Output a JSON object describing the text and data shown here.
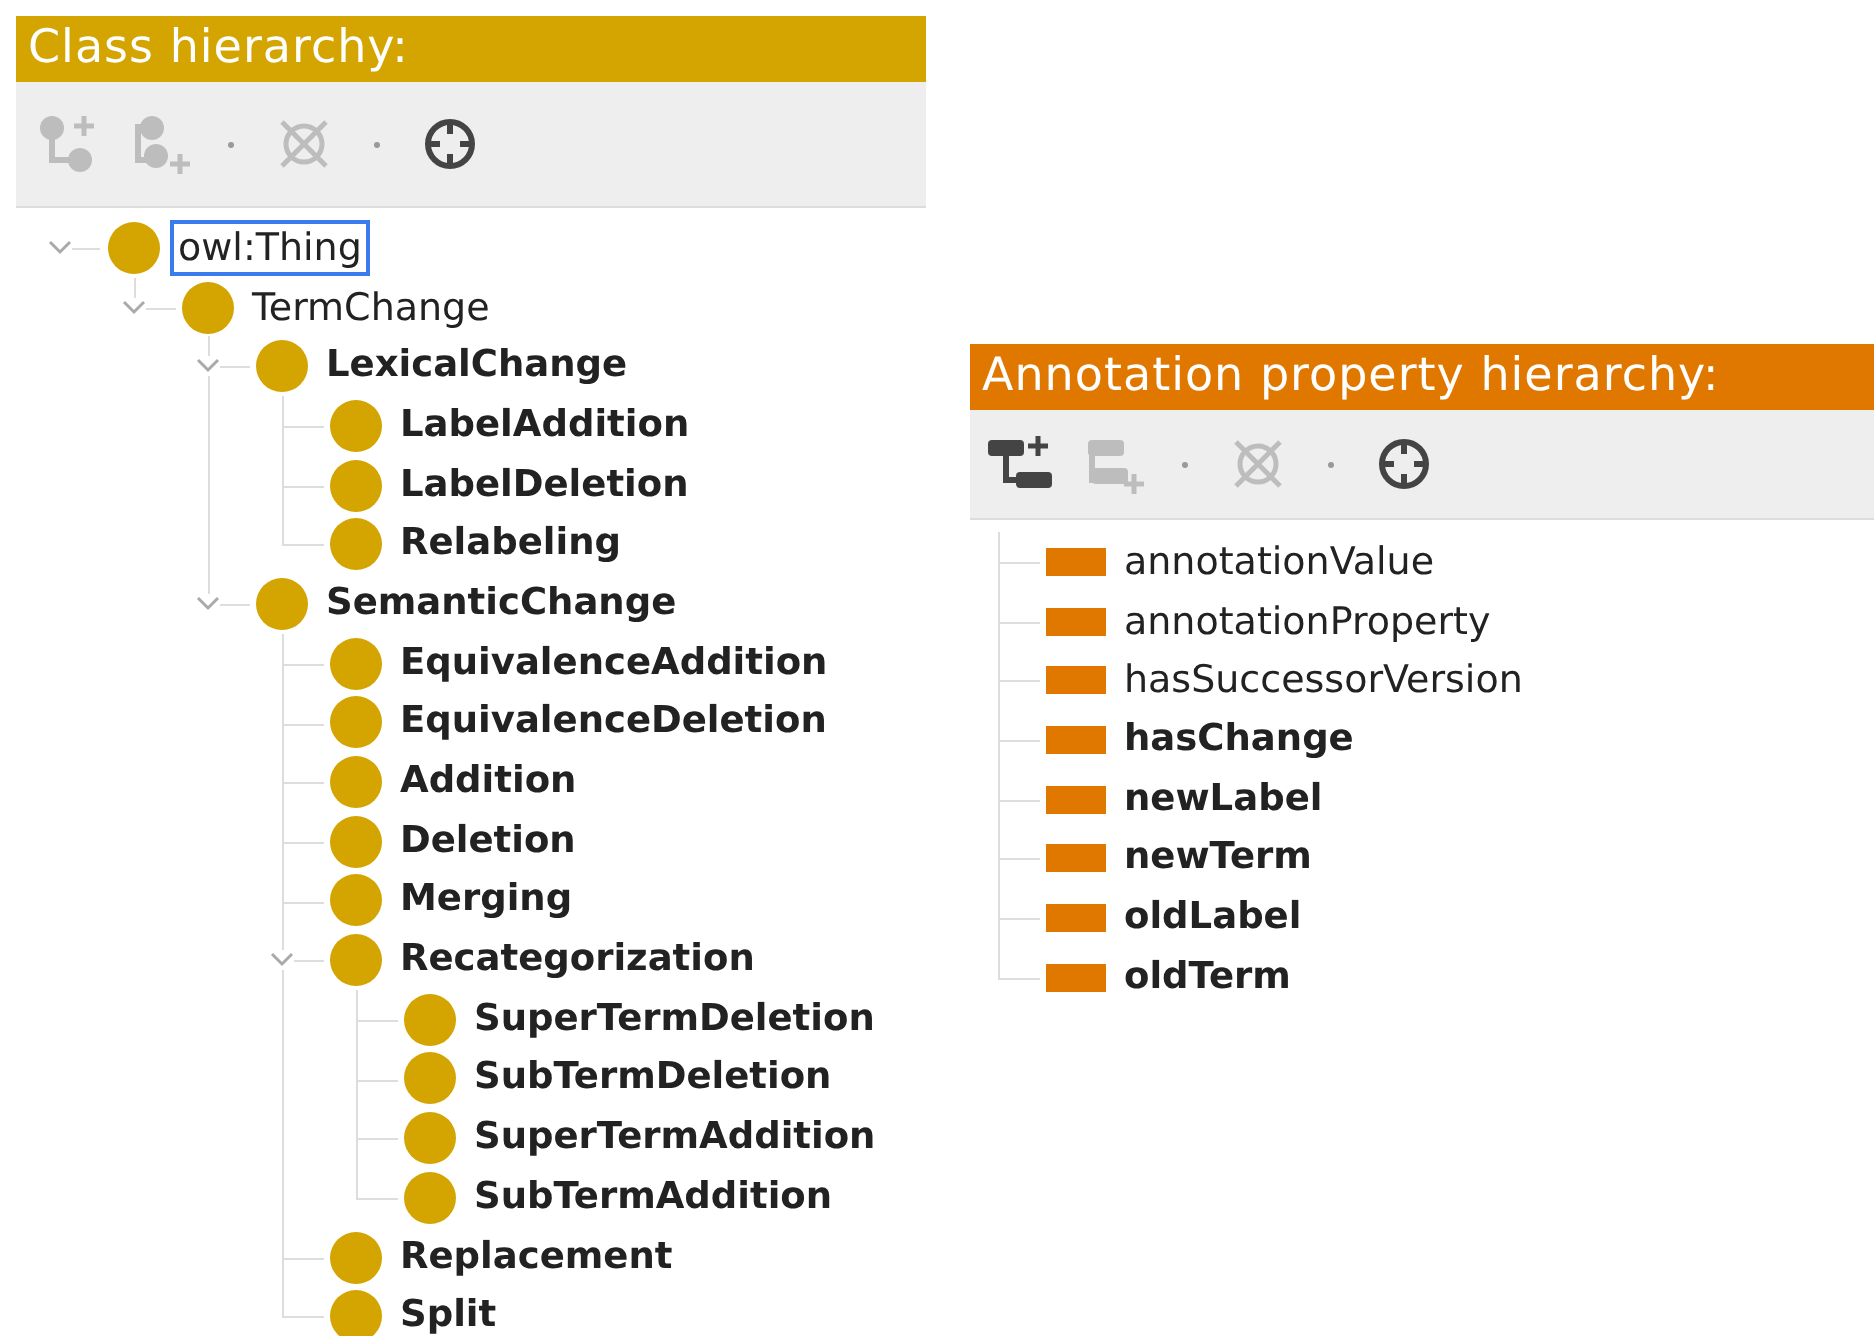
{
  "panels": [
    {
      "kind": "class",
      "title": "Class hierarchy:",
      "color": "#d4a400",
      "toolbar": [
        {
          "kind": "add-child",
          "disabled": true
        },
        {
          "kind": "add-sibling",
          "disabled": true
        },
        {
          "kind": "delete",
          "disabled": true
        },
        {
          "kind": "find",
          "disabled": false
        }
      ],
      "tree": [
        {
          "label": "owl:Thing",
          "bold": false,
          "selected": true,
          "expanded": true,
          "children": [
            {
              "label": "TermChange",
              "bold": false,
              "selected": false,
              "expanded": true,
              "children": [
                {
                  "label": "LexicalChange",
                  "bold": true,
                  "selected": false,
                  "expanded": true,
                  "children": [
                    {
                      "label": "LabelAddition",
                      "bold": true,
                      "selected": false
                    },
                    {
                      "label": "LabelDeletion",
                      "bold": true,
                      "selected": false
                    },
                    {
                      "label": "Relabeling",
                      "bold": true,
                      "selected": false
                    }
                  ]
                },
                {
                  "label": "SemanticChange",
                  "bold": true,
                  "selected": false,
                  "expanded": true,
                  "children": [
                    {
                      "label": "EquivalenceAddition",
                      "bold": true,
                      "selected": false
                    },
                    {
                      "label": "EquivalenceDeletion",
                      "bold": true,
                      "selected": false
                    },
                    {
                      "label": "Addition",
                      "bold": true,
                      "selected": false
                    },
                    {
                      "label": "Deletion",
                      "bold": true,
                      "selected": false
                    },
                    {
                      "label": "Merging",
                      "bold": true,
                      "selected": false
                    },
                    {
                      "label": "Recategorization",
                      "bold": true,
                      "selected": false,
                      "expanded": true,
                      "children": [
                        {
                          "label": "SuperTermDeletion",
                          "bold": true,
                          "selected": false
                        },
                        {
                          "label": "SubTermDeletion",
                          "bold": true,
                          "selected": false
                        },
                        {
                          "label": "SuperTermAddition",
                          "bold": true,
                          "selected": false
                        },
                        {
                          "label": "SubTermAddition",
                          "bold": true,
                          "selected": false
                        }
                      ]
                    },
                    {
                      "label": "Replacement",
                      "bold": true,
                      "selected": false
                    },
                    {
                      "label": "Split",
                      "bold": true,
                      "selected": false
                    }
                  ]
                }
              ]
            }
          ]
        }
      ]
    },
    {
      "kind": "annotation",
      "title": "Annotation property hierarchy:",
      "color": "#e07800",
      "toolbar": [
        {
          "kind": "add-child",
          "disabled": false
        },
        {
          "kind": "add-sibling",
          "disabled": true
        },
        {
          "kind": "delete",
          "disabled": true
        },
        {
          "kind": "find",
          "disabled": false
        }
      ],
      "tree": [
        {
          "label": "annotationValue",
          "bold": false,
          "selected": false
        },
        {
          "label": "annotationProperty",
          "bold": false,
          "selected": false
        },
        {
          "label": "hasSuccessorVersion",
          "bold": false,
          "selected": false
        },
        {
          "label": "hasChange",
          "bold": true,
          "selected": false
        },
        {
          "label": "newLabel",
          "bold": true,
          "selected": false
        },
        {
          "label": "newTerm",
          "bold": true,
          "selected": false
        },
        {
          "label": "oldLabel",
          "bold": true,
          "selected": false
        },
        {
          "label": "oldTerm",
          "bold": true,
          "selected": false
        }
      ]
    }
  ]
}
